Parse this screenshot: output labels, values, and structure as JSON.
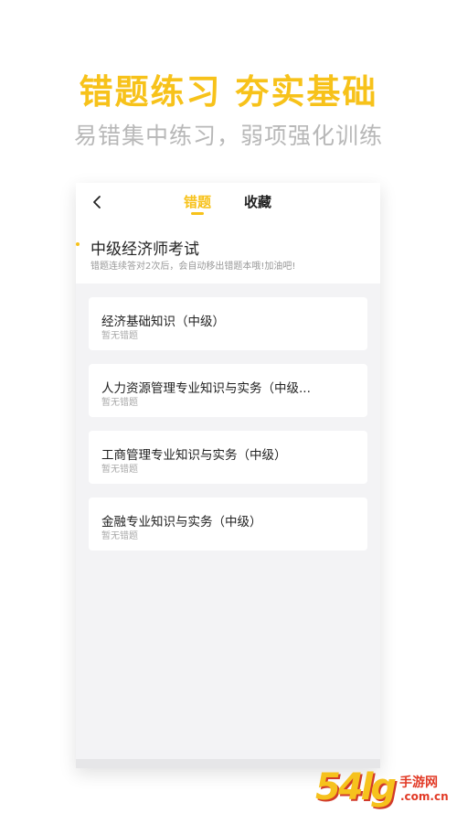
{
  "hero": {
    "title": "错题练习 夯实基础",
    "subtitle": "易错集中练习，弱项强化训练"
  },
  "topbar": {
    "tabs": [
      {
        "label": "错题",
        "active": true
      },
      {
        "label": "收藏",
        "active": false
      }
    ]
  },
  "exam": {
    "title": "中级经济师考试",
    "hint": "错题连续答对2次后，会自动移出错题本哦!加油吧!"
  },
  "subjects": [
    {
      "name": "经济基础知识（中级）",
      "status": "暂无错题"
    },
    {
      "name": "人力资源管理专业知识与实务（中级...",
      "status": "暂无错题"
    },
    {
      "name": "工商管理专业知识与实务（中级）",
      "status": "暂无错题"
    },
    {
      "name": "金融专业知识与实务（中级）",
      "status": "暂无错题"
    }
  ],
  "watermark": {
    "number": "54lg",
    "name": "手游网",
    "domain": ".com.cn"
  },
  "colors": {
    "accent": "#f7c21a",
    "subtitle": "#b8b8b8",
    "background": "#f3f3f5"
  },
  "icons": {
    "back": "chevron-left-icon"
  }
}
